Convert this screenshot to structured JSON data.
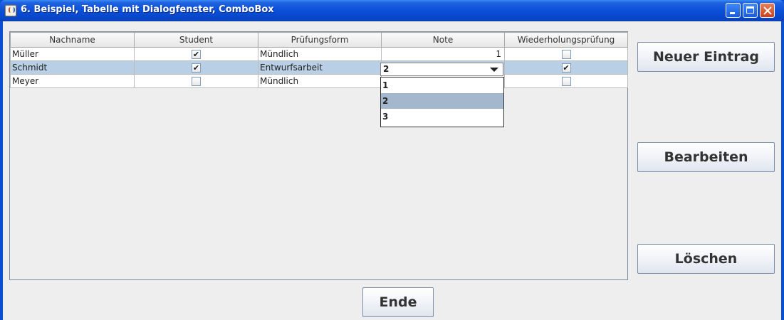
{
  "window": {
    "title": "6. Beispiel, Tabelle mit Dialogfenster, ComboBox"
  },
  "table": {
    "columns": [
      "Nachname",
      "Student",
      "Prüfungsform",
      "Note",
      "Wiederholungsprüfung"
    ],
    "rows": [
      {
        "nachname": "Müller",
        "student": true,
        "pruefungsform": "Mündlich",
        "note": "1",
        "wiederholung": false,
        "selected": false
      },
      {
        "nachname": "Schmidt",
        "student": true,
        "pruefungsform": "Entwurfsarbeit",
        "note": "2",
        "wiederholung": true,
        "selected": true
      },
      {
        "nachname": "Meyer",
        "student": false,
        "pruefungsform": "Mündlich",
        "note": "",
        "wiederholung": false,
        "selected": false
      }
    ]
  },
  "note_combo": {
    "value": "2",
    "options": [
      "1",
      "2",
      "3"
    ],
    "highlighted": "2"
  },
  "buttons": {
    "neuer_eintrag": "Neuer Eintrag",
    "bearbeiten": "Bearbeiten",
    "loeschen": "Löschen",
    "ende": "Ende"
  },
  "colors": {
    "titlebar": "#0a4fd8",
    "selection": "#b8cfe5",
    "popup_highlight": "#a3b8cc"
  }
}
